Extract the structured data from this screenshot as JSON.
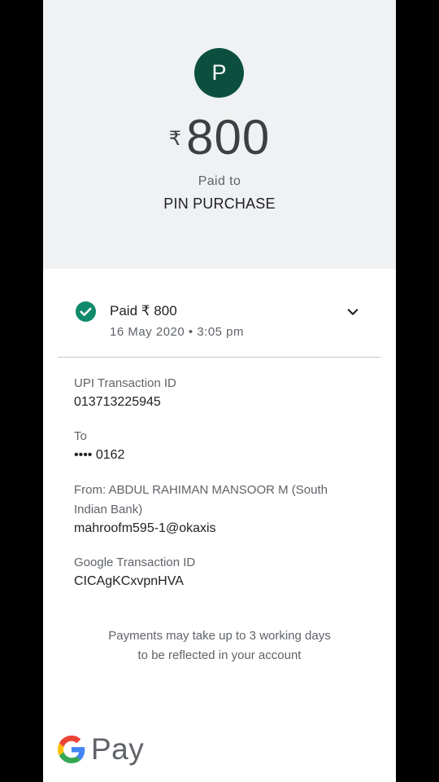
{
  "header": {
    "avatar_letter": "P",
    "currency_symbol": "₹",
    "amount": "800",
    "paid_to_label": "Paid to",
    "payee_name": "PIN PURCHASE"
  },
  "status": {
    "label": "Paid ₹ 800",
    "datetime": "16 May 2020 • 3:05 pm",
    "icon": "check-circle-icon",
    "expand_icon": "chevron-down-icon"
  },
  "details": {
    "upi_label": "UPI Transaction ID",
    "upi_value": "013713225945",
    "to_label": "To",
    "to_value": "•••• 0162",
    "from_label": "From: ABDUL RAHIMAN MANSOOR M (South Indian Bank)",
    "from_value": "mahroofm595-1@okaxis",
    "google_label": "Google Transaction ID",
    "google_value": "CICAgKCxvpnHVA"
  },
  "note": "Payments may take up to 3 working days to be reflected in your account",
  "footer": {
    "brand": "Pay"
  },
  "colors": {
    "avatar_bg": "#0c4f3f",
    "success_green": "#0f8a6b",
    "hero_bg": "#f0f1f2"
  }
}
